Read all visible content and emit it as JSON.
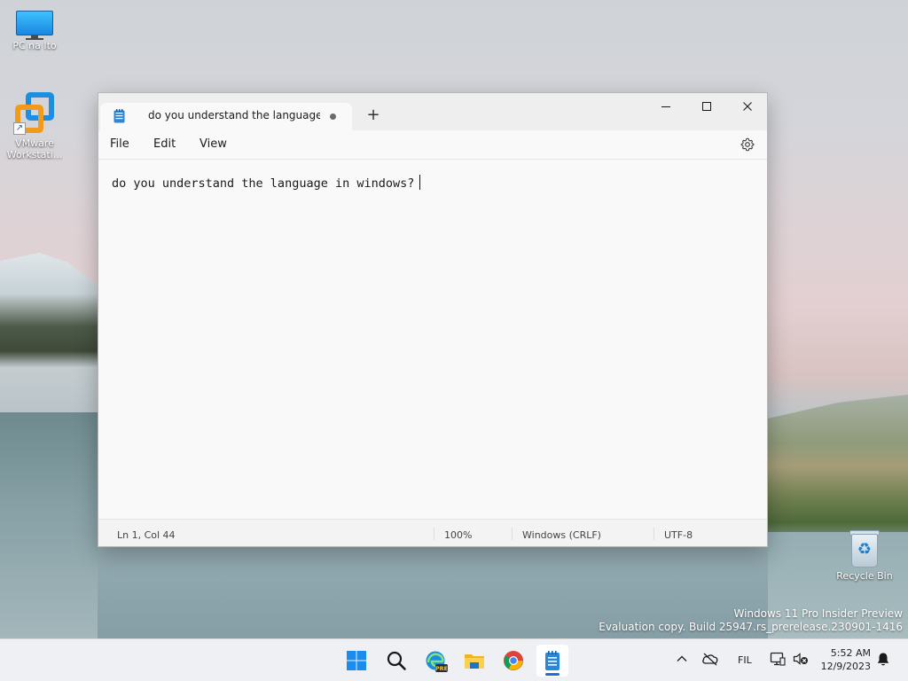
{
  "desktop": {
    "icons": [
      {
        "label": "PC na Ito"
      },
      {
        "label": "VMware Workstati..."
      },
      {
        "label": "Recycle Bin"
      }
    ],
    "watermark": {
      "line1": "Windows 11 Pro Insider Preview",
      "line2": "Evaluation copy. Build 25947.rs_prerelease.230901-1416"
    }
  },
  "notepad": {
    "tab_title": "do you understand the language ir",
    "tab_modified": true,
    "new_tab_label": "+",
    "menu": {
      "file": "File",
      "edit": "Edit",
      "view": "View"
    },
    "content": "do you understand the language in windows?",
    "status": {
      "position": "Ln 1, Col 44",
      "zoom": "100%",
      "line_ending": "Windows (CRLF)",
      "encoding": "UTF-8"
    }
  },
  "taskbar": {
    "apps": [
      "start-icon",
      "search-icon",
      "edge-icon",
      "file-explorer-icon",
      "chrome-icon",
      "notepad-icon"
    ],
    "edge_badge": "PRE",
    "tray": {
      "language": "FIL",
      "time": "5:52 AM",
      "date": "12/9/2023"
    }
  },
  "colors": {
    "accent": "#1f6fd0",
    "window_bg": "#f9f9f9",
    "taskbar_bg": "#eef0f4"
  }
}
